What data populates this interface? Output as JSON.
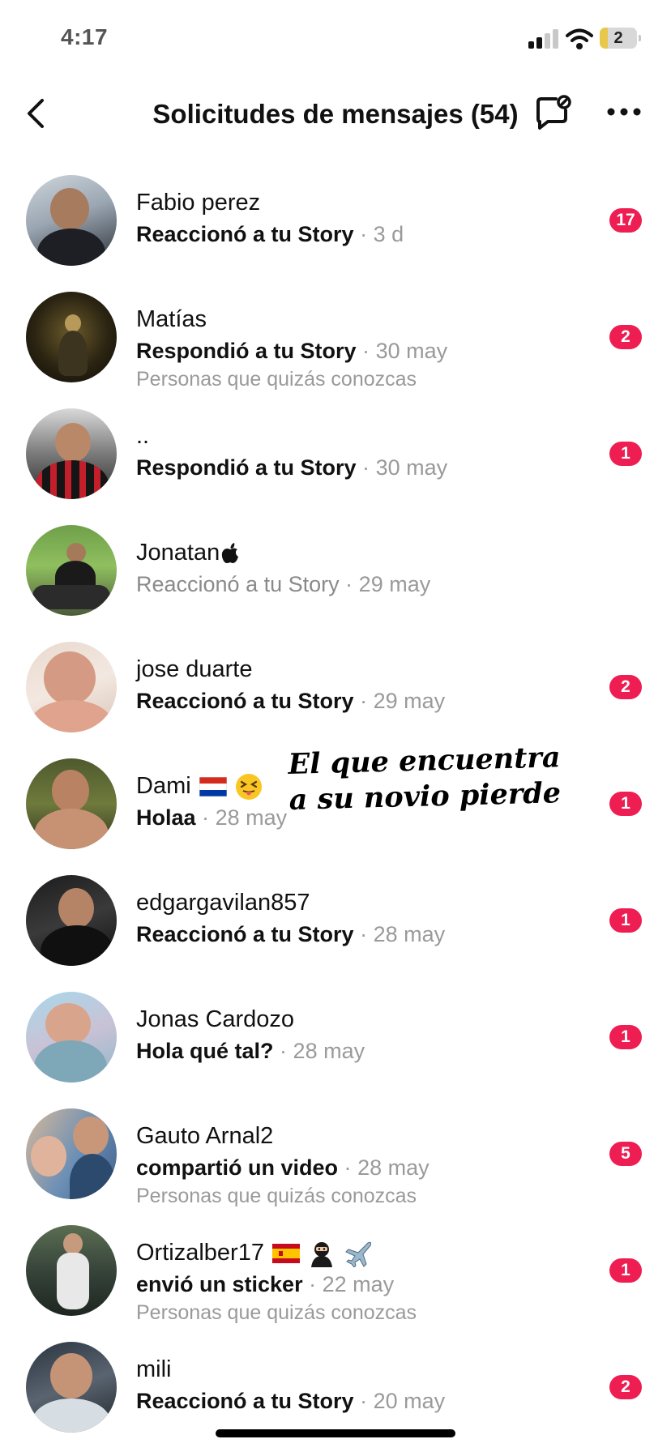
{
  "status_bar": {
    "time": "4:17",
    "battery": "2"
  },
  "header": {
    "title": "Solicitudes de mensajes (54)"
  },
  "overlay": {
    "line1": "El que encuentra",
    "line2": "a su novio pierde"
  },
  "requests": [
    {
      "name": "Fabio perez",
      "message": "Reaccionó a tu Story",
      "date": "3 d",
      "note": "",
      "badge": "17",
      "unread": true
    },
    {
      "name": "Matías",
      "message": "Respondió a tu Story",
      "date": "30 may",
      "note": "Personas que quizás conozcas",
      "badge": "2",
      "unread": true
    },
    {
      "name": "..",
      "message": "Respondió a tu Story",
      "date": "30 may",
      "note": "",
      "badge": "1",
      "unread": true
    },
    {
      "name": "Jonatan",
      "message": "Reaccionó a tu Story",
      "date": "29 may",
      "note": "",
      "badge": "",
      "unread": false
    },
    {
      "name": "jose duarte",
      "message": "Reaccionó a tu Story",
      "date": "29 may",
      "note": "",
      "badge": "2",
      "unread": true
    },
    {
      "name": "Dami",
      "message": "Holaa",
      "date": "28 may",
      "note": "",
      "badge": "1",
      "unread": true
    },
    {
      "name": "edgargavilan857",
      "message": "Reaccionó a tu Story",
      "date": "28 may",
      "note": "",
      "badge": "1",
      "unread": true
    },
    {
      "name": "Jonas Cardozo",
      "message": "Hola qué tal?",
      "date": "28 may",
      "note": "",
      "badge": "1",
      "unread": true
    },
    {
      "name": "Gauto Arnal2",
      "message": "compartió un video",
      "date": "28 may",
      "note": "Personas que quizás conozcas",
      "badge": "5",
      "unread": true
    },
    {
      "name": "Ortizalber17",
      "message": "envió un sticker",
      "date": "22 may",
      "note": "Personas que quizás conozcas",
      "badge": "1",
      "unread": true
    },
    {
      "name": "mili",
      "message": "Reaccionó a tu Story",
      "date": "20 may",
      "note": "",
      "badge": "2",
      "unread": true
    }
  ],
  "separator": "·",
  "colors": {
    "badge": "#ee1d52",
    "secondary_text": "#9a9a9a"
  },
  "icons": {
    "back": "chevron-left-icon",
    "compose": "message-settings-icon",
    "more": "more-horizontal-icon"
  }
}
